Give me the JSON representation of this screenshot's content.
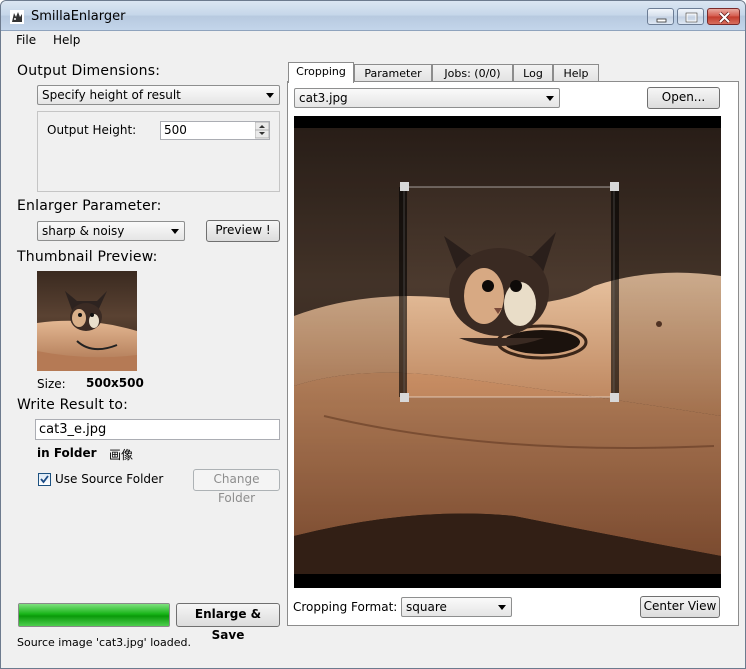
{
  "window": {
    "title": "SmillaEnlarger"
  },
  "menu": {
    "items": [
      "File",
      "Help"
    ]
  },
  "left": {
    "output_dimensions_heading": "Output Dimensions:",
    "dimension_mode": "Specify height of result",
    "output_height_label": "Output Height:",
    "output_height_value": "500",
    "enlarger_parameter_heading": "Enlarger Parameter:",
    "enlarger_preset": "sharp & noisy",
    "preview_button": "Preview !",
    "thumbnail_heading": "Thumbnail Preview:",
    "size_label": "Size:",
    "size_value": "500x500",
    "write_result_heading": "Write Result to:",
    "output_filename": "cat3_e.jpg",
    "in_folder_label": "in Folder",
    "folder_name": "画像",
    "use_source_folder_label": "Use Source Folder",
    "use_source_folder_checked": true,
    "change_folder_button": "Change Folder",
    "enlarge_save_button": "Enlarge & Save",
    "progress": 1.0,
    "progress_color": "#19b519"
  },
  "tabs": [
    "Cropping",
    "Parameter",
    "Jobs: (0/0)",
    "Log",
    "Help"
  ],
  "active_tab": "Cropping",
  "cropping": {
    "source_file": "cat3.jpg",
    "open_button": "Open...",
    "format_label": "Cropping Format:",
    "format_value": "square",
    "center_view_button": "Center View"
  },
  "status": {
    "message": "Source image 'cat3.jpg' loaded."
  }
}
